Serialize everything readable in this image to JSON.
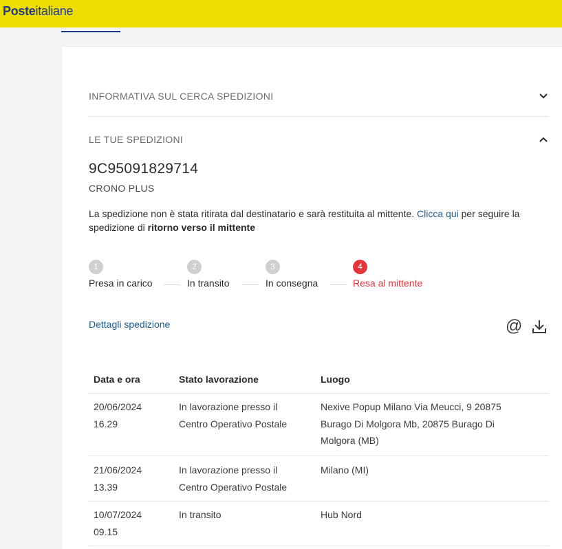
{
  "brand": {
    "logo_bold": "Poste",
    "logo_light": "italiane"
  },
  "accordion": {
    "info_title": "INFORMATIVA SUL CERCA SPEDIZIONI",
    "shipments_title": "LE TUE SPEDIZIONI"
  },
  "shipment": {
    "code": "9C95091829714",
    "service": "CRONO PLUS",
    "message_part1": "La spedizione non è stata ritirata dal destinatario e sarà restituita al mittente.",
    "message_link": "Clicca qui",
    "message_part2": "per seguire la spedizione di",
    "message_strong": "ritorno verso il mittente"
  },
  "steps": [
    {
      "number": "1",
      "label": "Presa in carico",
      "active": false
    },
    {
      "number": "2",
      "label": "In transito",
      "active": false
    },
    {
      "number": "3",
      "label": "In consegna",
      "active": false
    },
    {
      "number": "4",
      "label": "Resa al mittente",
      "active": true
    }
  ],
  "details_link": "Dettagli spedizione",
  "icons": {
    "email": "at-icon",
    "download": "download-icon",
    "info_chevron": "chevron-down-icon",
    "shipments_chevron": "chevron-up-icon"
  },
  "colors": {
    "brand_yellow": "#eedd00",
    "brand_blue": "#1d3a8a",
    "active_red": "#e5333a",
    "link_blue": "#1d5b8f"
  },
  "table": {
    "headers": [
      "Data e ora",
      "Stato lavorazione",
      "Luogo"
    ],
    "rows": [
      {
        "date": "20/06/2024",
        "time": "16.29",
        "status1": "In lavorazione presso il",
        "status2": "Centro Operativo Postale",
        "place1": "Nexive Popup Milano Via Meucci, 9 20875",
        "place2": "Burago Di Molgora Mb, 20875 Burago Di",
        "place3": "Molgora (MB)"
      },
      {
        "date": "21/06/2024",
        "time": "13.39",
        "status1": "In lavorazione presso il",
        "status2": "Centro Operativo Postale",
        "place1": "Milano (MI)"
      },
      {
        "date": "10/07/2024",
        "time": "09.15",
        "status1": "In transito",
        "place1": "Hub Nord"
      }
    ]
  }
}
